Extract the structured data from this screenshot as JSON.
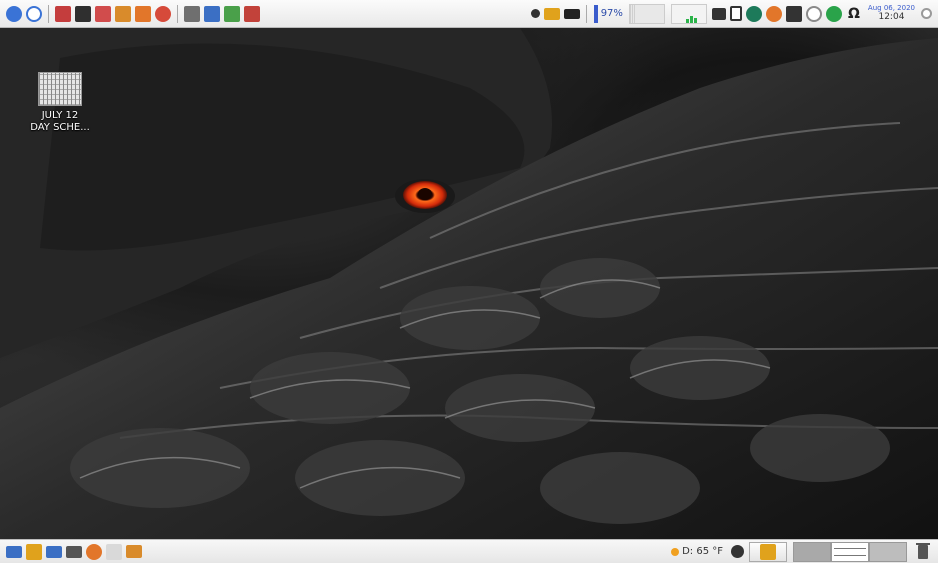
{
  "top_panel": {
    "launchers_left": [
      {
        "name": "menu-icon",
        "color": "#3a73d6"
      },
      {
        "name": "activities-icon",
        "color": "#3a73d6"
      },
      {
        "name": "screenshot-icon",
        "color": "#c43d3d"
      },
      {
        "name": "terminal-icon",
        "color": "#2f2f2f"
      },
      {
        "name": "tools-icon",
        "color": "#d14c4c"
      },
      {
        "name": "java-icon",
        "color": "#d98b2b"
      },
      {
        "name": "firefox-icon",
        "color": "#e2762a"
      },
      {
        "name": "chrome-icon",
        "color": "#d64a3a"
      }
    ],
    "launchers_mid": [
      {
        "name": "notes-icon",
        "color": "#6f6f6f"
      },
      {
        "name": "document-icon",
        "color": "#3b6fc4"
      },
      {
        "name": "puzzle-icon",
        "color": "#4aa04a"
      },
      {
        "name": "media-icon",
        "color": "#c2423a"
      }
    ],
    "tray": [
      {
        "name": "search-icon",
        "color": "#333333"
      },
      {
        "name": "archive-icon",
        "color": "#e0a21c"
      },
      {
        "name": "keyboard-icon",
        "color": "#222222"
      }
    ],
    "battery": {
      "percent_text": "97%"
    },
    "tray_right": [
      {
        "name": "volume-icon",
        "color": "#333333"
      },
      {
        "name": "clipboard-icon",
        "color": "#333333"
      },
      {
        "name": "shield-icon",
        "color": "#1d7a5a"
      },
      {
        "name": "chrome-tray-icon",
        "color": "#e2762a"
      },
      {
        "name": "display-icon",
        "color": "#333333"
      },
      {
        "name": "dropbox-icon",
        "color": "#8a8a8a"
      },
      {
        "name": "check-icon",
        "color": "#2aa34a"
      },
      {
        "name": "omega-icon",
        "color": "#222222"
      }
    ],
    "clock": {
      "date": "Aug 06, 2020",
      "time": "12:04"
    }
  },
  "desktop": {
    "icon": {
      "label_line1": "JULY 12",
      "label_line2": "DAY SCHE..."
    }
  },
  "bottom_panel": {
    "launchers": [
      {
        "name": "show-desktop-icon",
        "color": "#3b6fc4"
      },
      {
        "name": "files-icon",
        "color": "#e0a21c"
      },
      {
        "name": "mail-icon",
        "color": "#3b6fc4"
      },
      {
        "name": "calculator-icon",
        "color": "#555555"
      },
      {
        "name": "firefox-launcher-icon",
        "color": "#e2762a"
      },
      {
        "name": "java-launcher-icon",
        "color": "#d9d9d9"
      },
      {
        "name": "archive-launcher-icon",
        "color": "#d98b2b"
      }
    ],
    "weather": {
      "text": "D: 65 °F"
    }
  }
}
